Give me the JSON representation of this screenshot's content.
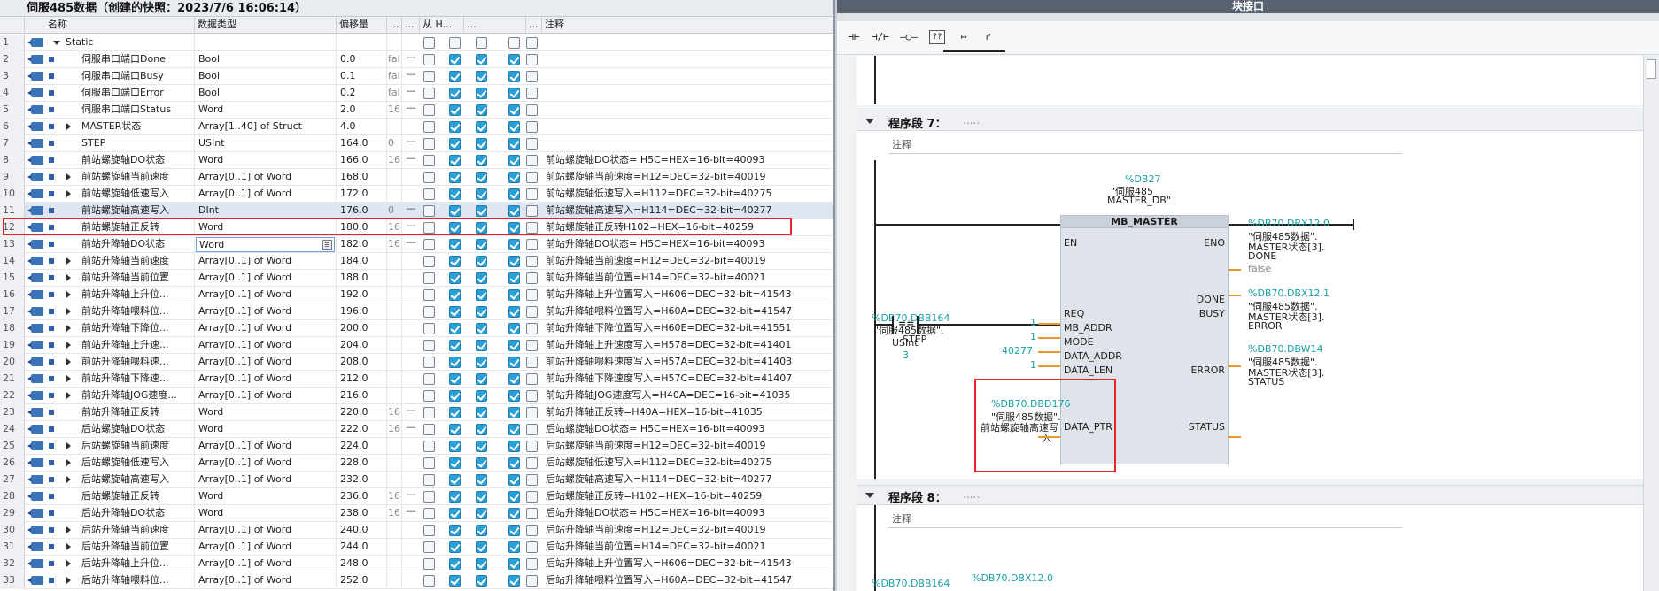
{
  "left_panel": {
    "title": "伺服485数据（创建的快照：2023/7/6 16:06:14）",
    "columns": {
      "name": "名称",
      "dtype": "数据类型",
      "offset": "偏移量",
      "c1": "...",
      "c2": "...",
      "c3": "从 H...",
      "c4": "...",
      "c5": "...",
      "comment": "注释"
    },
    "rows": [
      {
        "n": "1",
        "name": "Static",
        "type": "",
        "off": "",
        "sv": "",
        "dash": "",
        "c": [
          0,
          0,
          0,
          0,
          0
        ],
        "comment": "",
        "expand": "down",
        "indent": 0
      },
      {
        "n": "2",
        "name": "伺服串口端口Done",
        "type": "Bool",
        "off": "0.0",
        "sv": "fal:",
        "dash": "—",
        "c": [
          0,
          1,
          1,
          1,
          0
        ],
        "comment": "",
        "expand": "",
        "indent": 1
      },
      {
        "n": "3",
        "name": "伺服串口端口Busy",
        "type": "Bool",
        "off": "0.1",
        "sv": "fal:",
        "dash": "—",
        "c": [
          0,
          1,
          1,
          1,
          0
        ],
        "comment": "",
        "expand": "",
        "indent": 1
      },
      {
        "n": "4",
        "name": "伺服串口端口Error",
        "type": "Bool",
        "off": "0.2",
        "sv": "fal:",
        "dash": "—",
        "c": [
          0,
          1,
          1,
          1,
          0
        ],
        "comment": "",
        "expand": "",
        "indent": 1
      },
      {
        "n": "5",
        "name": "伺服串口端口Status",
        "type": "Word",
        "off": "2.0",
        "sv": "16",
        "dash": "—",
        "c": [
          0,
          1,
          1,
          1,
          0
        ],
        "comment": "",
        "expand": "",
        "indent": 1
      },
      {
        "n": "6",
        "name": "MASTER状态",
        "type": "Array[1..40] of Struct",
        "off": "4.0",
        "sv": "",
        "dash": "",
        "c": [
          0,
          1,
          1,
          1,
          0
        ],
        "comment": "",
        "expand": "right",
        "indent": 1
      },
      {
        "n": "7",
        "name": "STEP",
        "type": "USInt",
        "off": "164.0",
        "sv": "0",
        "dash": "—",
        "c": [
          0,
          1,
          1,
          1,
          0
        ],
        "comment": "",
        "expand": "",
        "indent": 1
      },
      {
        "n": "8",
        "name": "前站螺旋轴DO状态",
        "type": "Word",
        "off": "166.0",
        "sv": "16",
        "dash": "—",
        "c": [
          0,
          1,
          1,
          1,
          0
        ],
        "comment": "前站螺旋轴DO状态= H5C=HEX=16-bit=40093",
        "expand": "",
        "indent": 1
      },
      {
        "n": "9",
        "name": "前站螺旋轴当前速度",
        "type": "Array[0..1] of Word",
        "off": "168.0",
        "sv": "",
        "dash": "",
        "c": [
          0,
          1,
          1,
          1,
          0
        ],
        "comment": "前站螺旋轴当前速度=H12=DEC=32-bit=40019",
        "expand": "right",
        "indent": 1
      },
      {
        "n": "10",
        "name": "前站螺旋轴低速写入",
        "type": "Array[0..1] of Word",
        "off": "172.0",
        "sv": "",
        "dash": "",
        "c": [
          0,
          1,
          1,
          1,
          0
        ],
        "comment": "前站螺旋轴低速写入=H112=DEC=32-bit=40275",
        "expand": "right",
        "indent": 1
      },
      {
        "n": "11",
        "name": "前站螺旋轴高速写入",
        "type": "DInt",
        "off": "176.0",
        "sv": "0",
        "dash": "—",
        "c": [
          0,
          1,
          1,
          1,
          0
        ],
        "comment": "前站螺旋轴高速写入=H114=DEC=32-bit=40277",
        "expand": "",
        "indent": 1
      },
      {
        "n": "12",
        "name": "前站螺旋轴正反转",
        "type": "Word",
        "off": "180.0",
        "sv": "16",
        "dash": "—",
        "c": [
          0,
          1,
          1,
          1,
          0
        ],
        "comment": "前站螺旋轴正反转H102=HEX=16-bit=40259",
        "expand": "",
        "indent": 1
      },
      {
        "n": "13",
        "name": "前站升降轴DO状态",
        "type": "Word",
        "off": "182.0",
        "sv": "16",
        "dash": "—",
        "c": [
          0,
          1,
          1,
          1,
          0
        ],
        "comment": "前站升降轴DO状态= H5C=HEX=16-bit=40093",
        "expand": "",
        "indent": 1
      },
      {
        "n": "14",
        "name": "前站升降轴当前速度",
        "type": "Array[0..1] of Word",
        "off": "184.0",
        "sv": "",
        "dash": "",
        "c": [
          0,
          1,
          1,
          1,
          0
        ],
        "comment": "前站升降轴当前速度=H12=DEC=32-bit=40019",
        "expand": "right",
        "indent": 1
      },
      {
        "n": "15",
        "name": "前站升降轴当前位置",
        "type": "Array[0..1] of Word",
        "off": "188.0",
        "sv": "",
        "dash": "",
        "c": [
          0,
          1,
          1,
          1,
          0
        ],
        "comment": "前站升降轴当前位置=H14=DEC=32-bit=40021",
        "expand": "right",
        "indent": 1
      },
      {
        "n": "16",
        "name": "前站升降轴上升位...",
        "type": "Array[0..1] of Word",
        "off": "192.0",
        "sv": "",
        "dash": "",
        "c": [
          0,
          1,
          1,
          1,
          0
        ],
        "comment": "前站升降轴上升位置写入=H606=DEC=32-bit=41543",
        "expand": "right",
        "indent": 1
      },
      {
        "n": "17",
        "name": "前站升降轴喂料位...",
        "type": "Array[0..1] of Word",
        "off": "196.0",
        "sv": "",
        "dash": "",
        "c": [
          0,
          1,
          1,
          1,
          0
        ],
        "comment": "前站升降轴喂料位置写入=H60A=DEC=32-bit=41547",
        "expand": "right",
        "indent": 1
      },
      {
        "n": "18",
        "name": "前站升降轴下降位...",
        "type": "Array[0..1] of Word",
        "off": "200.0",
        "sv": "",
        "dash": "",
        "c": [
          0,
          1,
          1,
          1,
          0
        ],
        "comment": "前站升降轴下降位置写入=H60E=DEC=32-bit=41551",
        "expand": "right",
        "indent": 1
      },
      {
        "n": "19",
        "name": "前站升降轴上升速...",
        "type": "Array[0..1] of Word",
        "off": "204.0",
        "sv": "",
        "dash": "",
        "c": [
          0,
          1,
          1,
          1,
          0
        ],
        "comment": "前站升降轴上升速度写入=H578=DEC=32-bit=41401",
        "expand": "right",
        "indent": 1
      },
      {
        "n": "20",
        "name": "前站升降轴喂料速...",
        "type": "Array[0..1] of Word",
        "off": "208.0",
        "sv": "",
        "dash": "",
        "c": [
          0,
          1,
          1,
          1,
          0
        ],
        "comment": "前站升降轴喂料速度写入=H57A=DEC=32-bit=41403",
        "expand": "right",
        "indent": 1
      },
      {
        "n": "21",
        "name": "前站升降轴下降速...",
        "type": "Array[0..1] of Word",
        "off": "212.0",
        "sv": "",
        "dash": "",
        "c": [
          0,
          1,
          1,
          1,
          0
        ],
        "comment": "前站升降轴下降速度写入=H57C=DEC=32-bit=41407",
        "expand": "right",
        "indent": 1
      },
      {
        "n": "22",
        "name": "前站升降轴JOG速度...",
        "type": "Array[0..1] of Word",
        "off": "216.0",
        "sv": "",
        "dash": "",
        "c": [
          0,
          1,
          1,
          1,
          0
        ],
        "comment": "前站升降轴JOG速度写入=H40A=DEC=16-bit=41035",
        "expand": "right",
        "indent": 1
      },
      {
        "n": "23",
        "name": "前站升降轴正反转",
        "type": "Word",
        "off": "220.0",
        "sv": "16",
        "dash": "—",
        "c": [
          0,
          1,
          1,
          1,
          0
        ],
        "comment": "前站升降轴正反转=H40A=HEX=16-bit=41035",
        "expand": "",
        "indent": 1
      },
      {
        "n": "24",
        "name": "后站螺旋轴DO状态",
        "type": "Word",
        "off": "222.0",
        "sv": "16",
        "dash": "—",
        "c": [
          0,
          1,
          1,
          1,
          0
        ],
        "comment": "后站螺旋轴DO状态= H5C=HEX=16-bit=40093",
        "expand": "",
        "indent": 1
      },
      {
        "n": "25",
        "name": "后站螺旋轴当前速度",
        "type": "Array[0..1] of Word",
        "off": "224.0",
        "sv": "",
        "dash": "",
        "c": [
          0,
          1,
          1,
          1,
          0
        ],
        "comment": "后站螺旋轴当前速度=H12=DEC=32-bit=40019",
        "expand": "right",
        "indent": 1
      },
      {
        "n": "26",
        "name": "后站螺旋轴低速写入",
        "type": "Array[0..1] of Word",
        "off": "228.0",
        "sv": "",
        "dash": "",
        "c": [
          0,
          1,
          1,
          1,
          0
        ],
        "comment": "后站螺旋轴低速写入=H112=DEC=32-bit=40275",
        "expand": "right",
        "indent": 1
      },
      {
        "n": "27",
        "name": "后站螺旋轴高速写入",
        "type": "Array[0..1] of Word",
        "off": "232.0",
        "sv": "",
        "dash": "",
        "c": [
          0,
          1,
          1,
          1,
          0
        ],
        "comment": "后站螺旋轴高速写入=H114=DEC=32-bit=40277",
        "expand": "right",
        "indent": 1
      },
      {
        "n": "28",
        "name": "后站螺旋轴正反转",
        "type": "Word",
        "off": "236.0",
        "sv": "16",
        "dash": "—",
        "c": [
          0,
          1,
          1,
          1,
          0
        ],
        "comment": "后站螺旋轴正反转=H102=HEX=16-bit=40259",
        "expand": "",
        "indent": 1
      },
      {
        "n": "29",
        "name": "后站升降轴DO状态",
        "type": "Word",
        "off": "238.0",
        "sv": "16",
        "dash": "—",
        "c": [
          0,
          1,
          1,
          1,
          0
        ],
        "comment": "后站升降轴DO状态= H5C=HEX=16-bit=40093",
        "expand": "",
        "indent": 1
      },
      {
        "n": "30",
        "name": "后站升降轴当前速度",
        "type": "Array[0..1] of Word",
        "off": "240.0",
        "sv": "",
        "dash": "",
        "c": [
          0,
          1,
          1,
          1,
          0
        ],
        "comment": "后站升降轴当前速度=H12=DEC=32-bit=40019",
        "expand": "right",
        "indent": 1
      },
      {
        "n": "31",
        "name": "后站升降轴当前位置",
        "type": "Array[0..1] of Word",
        "off": "244.0",
        "sv": "",
        "dash": "",
        "c": [
          0,
          1,
          1,
          1,
          0
        ],
        "comment": "后站升降轴当前位置=H14=DEC=32-bit=40021",
        "expand": "right",
        "indent": 1
      },
      {
        "n": "32",
        "name": "后站升降轴上升位...",
        "type": "Array[0..1] of Word",
        "off": "248.0",
        "sv": "",
        "dash": "",
        "c": [
          0,
          1,
          1,
          1,
          0
        ],
        "comment": "后站升降轴上升位置写入=H606=DEC=32-bit=41543",
        "expand": "right",
        "indent": 1
      },
      {
        "n": "33",
        "name": "后站升降轴喂料位...",
        "type": "Array[0..1] of Word",
        "off": "252.0",
        "sv": "",
        "dash": "",
        "c": [
          0,
          1,
          1,
          1,
          0
        ],
        "comment": "后站升降轴喂料位置写入=H60A=DEC=32-bit=41547",
        "expand": "right",
        "indent": 1
      }
    ],
    "selected_row": "11",
    "editing_row": "13",
    "editing_value": "Word"
  },
  "right_panel": {
    "title": "块接口",
    "toolbar": [
      "⊣⊢",
      "⊣/⊢",
      "–○–",
      "??",
      "↦",
      "↱"
    ],
    "network7": {
      "title": "程序段 7：",
      "dots": ".....",
      "comment": "注释",
      "block_addr": "%DB27",
      "block_name1": "\"伺服485_",
      "block_name2": "MASTER_DB\"",
      "block_type": "MB_MASTER",
      "en": "EN",
      "eno": "ENO",
      "step_addr": "%DB70.DBB164",
      "step_name1": "\"伺服485数据\".",
      "step_name2": "STEP",
      "cmp_op": "==",
      "cmp_type": "USInt",
      "cmp_val": "3",
      "req": "REQ",
      "mb_addr_val": "1",
      "mb_addr": "MB_ADDR",
      "mode_val": "1",
      "mode": "MODE",
      "data_addr_val": "40277",
      "data_addr": "DATA_ADDR",
      "data_len_val": "1",
      "data_len": "DATA_LEN",
      "data_ptr_addr": "%DB70.DBD176",
      "data_ptr_name1": "\"伺服485数据\".",
      "data_ptr_name2": "前站螺旋轴高速写",
      "data_ptr_name3": "入",
      "data_ptr": "DATA_PTR",
      "done": "DONE",
      "busy": "BUSY",
      "busy_val": "false",
      "error": "ERROR",
      "status": "STATUS",
      "done_addr": "%DB70.DBX12.0",
      "done_n1": "\"伺服485数据\".",
      "done_n2": "MASTER状态[3].",
      "done_n3": "DONE",
      "err_addr": "%DB70.DBX12.1",
      "err_n1": "\"伺服485数据\".",
      "err_n2": "MASTER状态[3].",
      "err_n3": "ERROR",
      "st_addr": "%DB70.DBW14",
      "st_n1": "\"伺服485数据\".",
      "st_n2": "MASTER状态[3].",
      "st_n3": "STATUS"
    },
    "network8": {
      "title": "程序段 8：",
      "dots": ".....",
      "comment": "注释",
      "addr1": "%DB70.DBB164",
      "addr2": "%DB70.DBX12.0"
    }
  },
  "colors": {
    "accent": "#2aa0d6",
    "highlight": "#e82222",
    "teal": "#1aa0a8",
    "wire": "#e69a2a"
  }
}
